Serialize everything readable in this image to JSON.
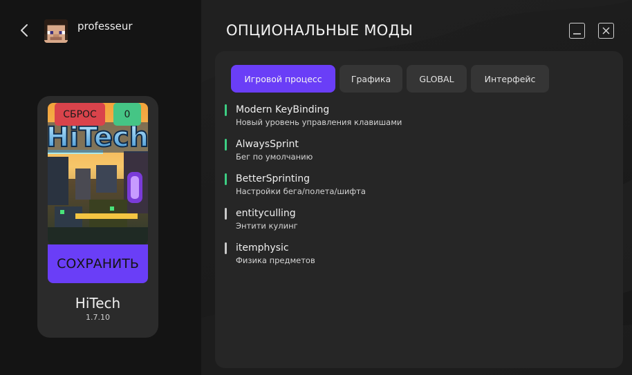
{
  "user": {
    "name": "professeur",
    "avatar_icon": "player-head-icon"
  },
  "modpack": {
    "reset_label": "СБРОС",
    "counter": "0",
    "save_label": "СОХРАНИТЬ",
    "name": "HiTech",
    "version": "1.7.10",
    "art_text": "HiTech"
  },
  "page": {
    "title": "ОПЦИОНАЛЬНЫЕ МОДЫ"
  },
  "tabs": [
    {
      "label": "Игровой процесс",
      "active": true
    },
    {
      "label": "Графика",
      "active": false
    },
    {
      "label": "GLOBAL",
      "active": false
    },
    {
      "label": "Интерфейс",
      "active": false
    }
  ],
  "mods": [
    {
      "name": "Modern KeyBinding",
      "description": "Новый уровень управления клавишами",
      "enabled": true
    },
    {
      "name": "AlwaysSprint",
      "description": "Бег по умолчанию",
      "enabled": true
    },
    {
      "name": "BetterSprinting",
      "description": "Настройки бега/полета/шифта",
      "enabled": true
    },
    {
      "name": "entityculling",
      "description": "Энтити кулинг",
      "enabled": false
    },
    {
      "name": "itemphysic",
      "description": "Физика предметов",
      "enabled": false
    }
  ],
  "colors": {
    "accent": "#6a3ef7",
    "reset": "#d9434b",
    "counter": "#45c585",
    "enabled_indicator": "#3ccf83",
    "disabled_indicator": "#c9c9c9"
  }
}
